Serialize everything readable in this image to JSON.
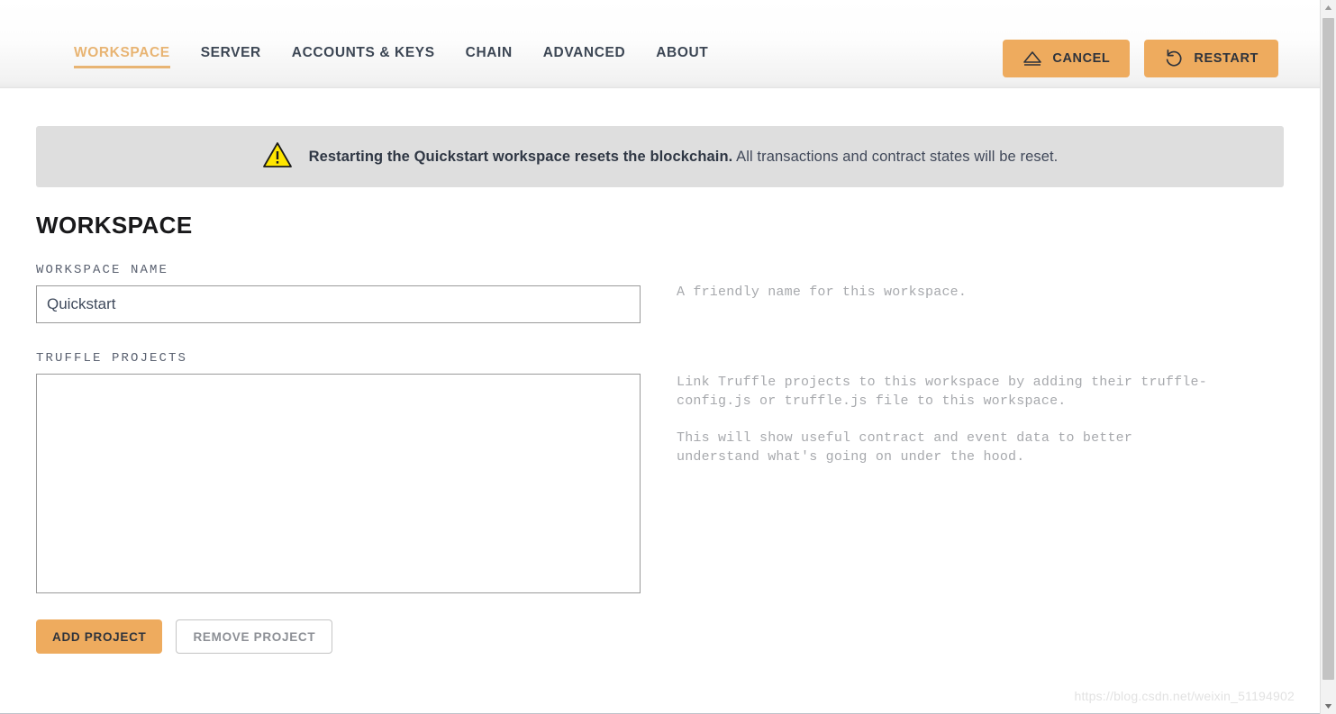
{
  "header": {
    "nav": [
      {
        "label": "WORKSPACE",
        "active": true
      },
      {
        "label": "SERVER",
        "active": false
      },
      {
        "label": "ACCOUNTS & KEYS",
        "active": false
      },
      {
        "label": "CHAIN",
        "active": false
      },
      {
        "label": "ADVANCED",
        "active": false
      },
      {
        "label": "ABOUT",
        "active": false
      }
    ],
    "actions": {
      "cancel_label": "CANCEL",
      "cancel_icon": "eject-triangle-icon",
      "restart_label": "RESTART",
      "restart_icon": "restart-arrow-icon"
    }
  },
  "banner": {
    "icon": "warning-triangle-icon",
    "bold_text": "Restarting the Quickstart workspace resets the blockchain.",
    "rest_text": " All transactions and contract states will be reset."
  },
  "main": {
    "title": "WORKSPACE",
    "workspace_name": {
      "label": "WORKSPACE NAME",
      "value": "Quickstart",
      "help": "A friendly name for this workspace."
    },
    "truffle_projects": {
      "label": "TRUFFLE PROJECTS",
      "value": "",
      "help_1": "Link Truffle projects to this workspace by adding their truffle-config.js or truffle.js file to this workspace.",
      "help_2": "This will show useful contract and event data to better understand what's going on under the hood."
    },
    "buttons": {
      "add_label": "ADD PROJECT",
      "remove_label": "REMOVE PROJECT"
    }
  },
  "watermark": {
    "text": "https://blog.csdn.net/weixin_51194902"
  },
  "colors": {
    "accent": "#eeab5e",
    "active_tab": "#e8b473",
    "banner_bg": "#dedede",
    "warning_yellow": "#ffe600",
    "help_text": "#a7a9ad"
  },
  "scrollbar": {
    "up_icon": "scroll-up-arrow-icon",
    "down_icon": "scroll-down-arrow-icon"
  }
}
